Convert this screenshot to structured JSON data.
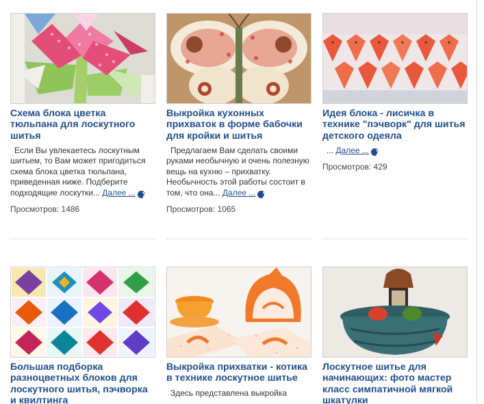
{
  "cards": [
    {
      "title": "Схема блока цветка тюльпана для лоскутного шитья",
      "excerpt": "Если Вы увлекаетесь лоскутным шитьем, то Вам может пригодиться схема блока цветка тюльпана, приведенная ниже. Подберите подходящие лоскутки...",
      "more_label": "Далее ...",
      "views": "Просмотров: 1486"
    },
    {
      "title": "Выкройка кухонных прихваток в форме бабочки для кройки и шитья",
      "excerpt": "Предлагаем Вам сделать своими руками необычную и очень полезную вещь на кухню – прихватку. Необычность этой работы состоит в том, что она...",
      "more_label": "Далее ...",
      "views": "Просмотров: 1065"
    },
    {
      "title": "Идея блока - лисичка в технике \"пэчворк\" для шитья детского одеяла",
      "excerpt": "...",
      "more_label": "Далее ...",
      "views": "Просмотров: 429"
    },
    {
      "title": "Большая подборка разноцветных блоков для лоскутного шитья, пэчворка и квилтинга",
      "excerpt": "",
      "more_label": "",
      "views": ""
    },
    {
      "title": "Выкройка прихватки - котика в технике лоскутное шитье",
      "excerpt": "Здесь представлена выкройка",
      "more_label": "",
      "views": ""
    },
    {
      "title": "Лоскутное шитье для начинающих: фото мастер класс симпатичной мягкой шкатулки",
      "excerpt": "",
      "more_label": "",
      "views": ""
    }
  ],
  "icons": {
    "more": "arrow-right-circle-icon"
  },
  "colors": {
    "title": "#1f4e8c",
    "text": "#333333",
    "border": "#cfcfcf"
  }
}
